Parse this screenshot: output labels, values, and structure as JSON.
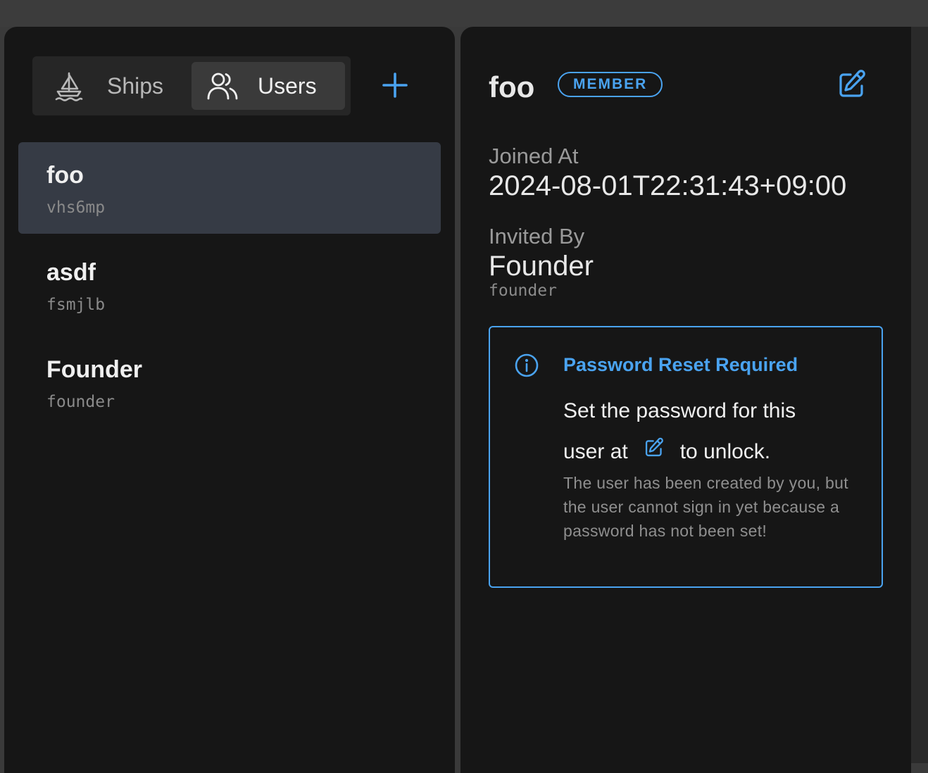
{
  "nav": {
    "tabs": [
      {
        "label": "Ships",
        "icon": "sailboat-icon"
      },
      {
        "label": "Users",
        "icon": "users-icon"
      }
    ],
    "active_tab": "Users",
    "add_icon": "plus-icon"
  },
  "users": [
    {
      "name": "foo",
      "id": "vhs6mp",
      "selected": true
    },
    {
      "name": "asdf",
      "id": "fsmjlb",
      "selected": false
    },
    {
      "name": "Founder",
      "id": "founder",
      "selected": false
    }
  ],
  "detail": {
    "name": "foo",
    "role": "MEMBER",
    "edit_icon": "edit-icon",
    "joined_label": "Joined At",
    "joined_value": "2024-08-01T22:31:43+09:00",
    "invited_label": "Invited By",
    "invited_name": "Founder",
    "invited_id": "founder"
  },
  "notice": {
    "icon": "info-icon",
    "title": "Password Reset Required",
    "line1": "Set the password for this",
    "line2_pre": "user at",
    "line2_post": "to unlock.",
    "description": "The user has been created by you, but the user cannot sign in yet because a password has not been set!"
  },
  "colors": {
    "accent": "#4aa3f0",
    "panel_bg": "#161616",
    "selected_bg": "#363b45"
  }
}
